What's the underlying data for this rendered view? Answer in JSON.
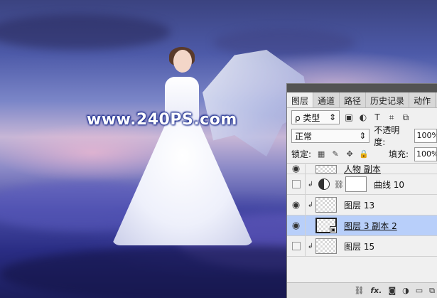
{
  "watermark": "www.240PS.com",
  "panel": {
    "tabs": [
      "图层",
      "通道",
      "路径",
      "历史记录",
      "动作"
    ],
    "filter": {
      "label": "ρ 类型",
      "icons": [
        "image-filter-icon",
        "adjustment-filter-icon",
        "type-filter-icon",
        "shape-filter-icon",
        "smart-object-filter-icon"
      ]
    },
    "blend_mode": "正常",
    "opacity_label": "不透明度:",
    "opacity_value": "100%",
    "lock_label": "锁定:",
    "fill_label": "填充:",
    "fill_value": "100%",
    "layers": [
      {
        "name": "人物 副本",
        "visible": true,
        "clipped": false,
        "thumb": "photo",
        "selected": false
      },
      {
        "name": "曲线 10",
        "visible": false,
        "clipped": true,
        "thumb": "white",
        "selected": false
      },
      {
        "name": "图层 13",
        "visible": true,
        "clipped": true,
        "thumb": "transparent",
        "selected": false
      },
      {
        "name": "图层 3 副本 2",
        "visible": true,
        "clipped": false,
        "thumb": "smart",
        "selected": true
      },
      {
        "name": "图层 15",
        "visible": false,
        "clipped": true,
        "thumb": "transparent",
        "selected": false
      }
    ],
    "bottom_icons": [
      "link-icon",
      "fx-icon",
      "mask-icon",
      "adjustment-icon",
      "folder-icon",
      "new-layer-icon"
    ],
    "bottom_fx": "fx."
  }
}
